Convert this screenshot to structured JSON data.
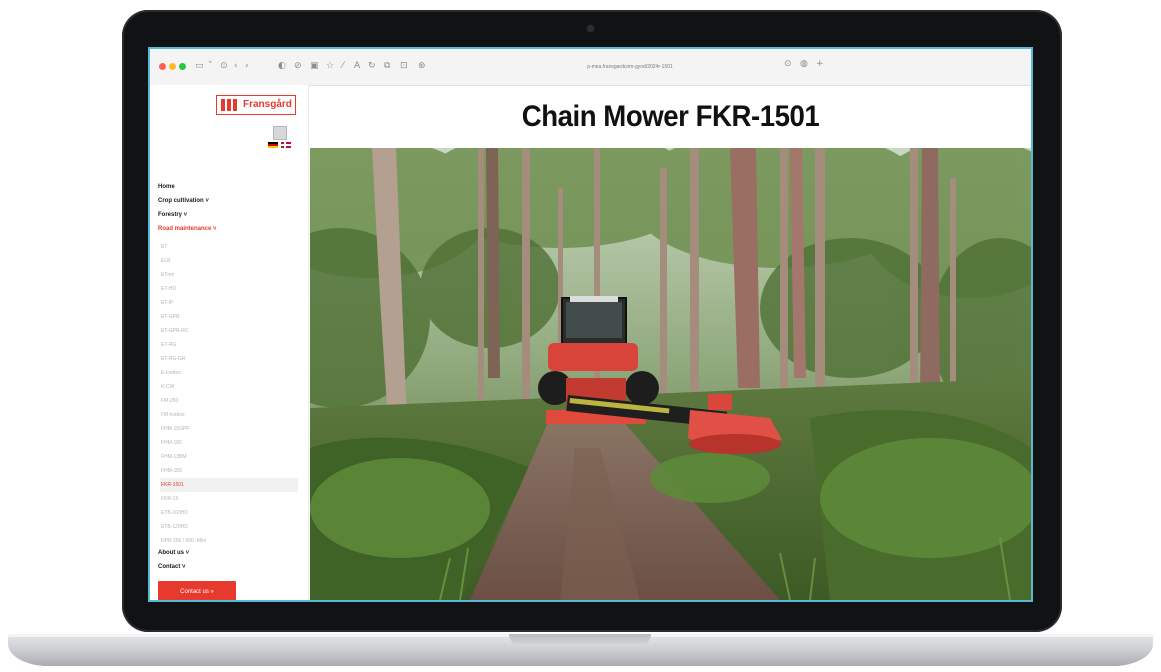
{
  "browser": {
    "url": "p-mea.fransgardcom-gyod/2024r-1501",
    "toolbar_icons": [
      "sidebar-icon",
      "chevron-down-icon",
      "back-icon",
      "forward-icon",
      "shield-icon",
      "reader-icon",
      "share-icon",
      "star-icon"
    ]
  },
  "brand": {
    "logo_text": "Fransgård",
    "accent": "#e63a2e"
  },
  "page": {
    "title": "Chain Mower FKR-1501"
  },
  "nav": {
    "top_items": [
      {
        "label": "Home",
        "active": false
      },
      {
        "label": "Crop cultivation  ˅",
        "active": false
      },
      {
        "label": "Forestry  ˅",
        "active": false
      },
      {
        "label": "Road maintenance  ˅",
        "active": true
      }
    ],
    "sub_items": [
      "ET",
      "ELB",
      "ETnm",
      "ET-HD",
      "ET-IP",
      "ET-GPR",
      "ET-GPR-RC",
      "ET-RG",
      "ET-RG-GR",
      "E-Icebox",
      "K-CW",
      "FM-250",
      "FM-Icebox",
      "FHM-15GPP",
      "FHM-182",
      "FHM-13BM",
      "FHM-183",
      "FKR-1501",
      "FKR-15",
      "ETB-100HD",
      "ETB-120HD",
      "DPR 250 / 500 -Mini"
    ],
    "current_sub_index": 17,
    "lower_items": [
      "About us  ˅",
      "Contact  ˅"
    ],
    "contact_button": "Contact us »"
  },
  "social": {
    "facebook": "f",
    "mail": "✉"
  }
}
